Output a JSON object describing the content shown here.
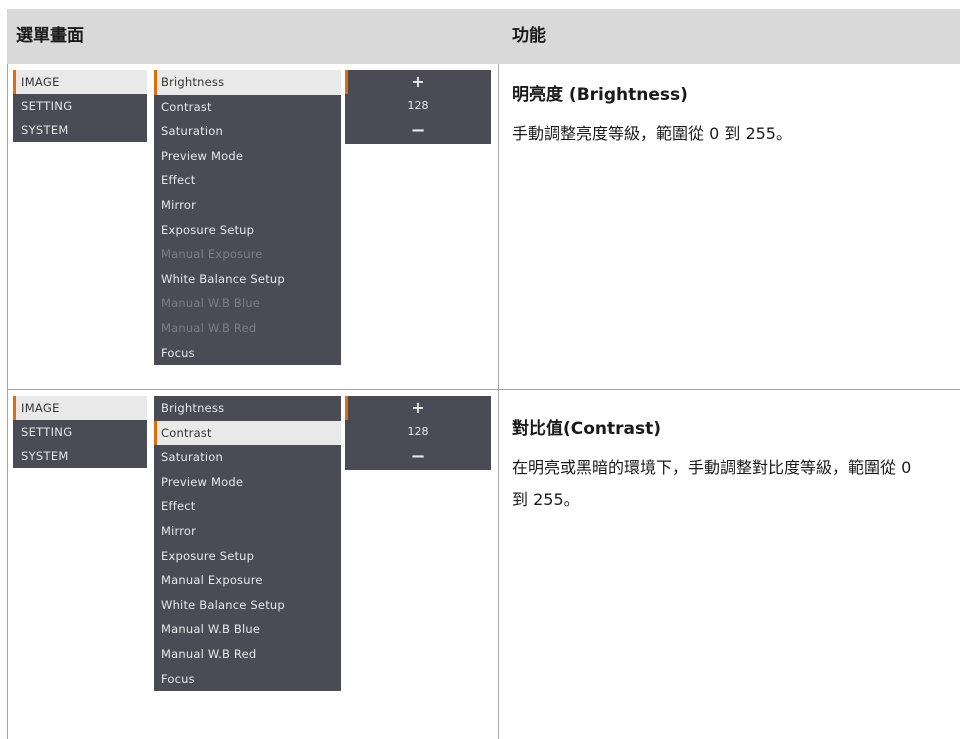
{
  "header": {
    "col1": "選單畫面",
    "col2": "功能"
  },
  "menu": {
    "categories": [
      "IMAGE",
      "SETTING",
      "SYSTEM"
    ],
    "value_panel": {
      "plus": "+",
      "value": "128",
      "minus": "−"
    }
  },
  "rows": [
    {
      "items": [
        "Brightness",
        "Contrast",
        "Saturation",
        "Preview Mode",
        "Effect",
        "Mirror",
        "Exposure Setup",
        "Manual Exposure",
        "White Balance Setup",
        "Manual W.B Blue",
        "Manual W.B Red",
        "Focus"
      ],
      "title": "明亮度 (Brightness)",
      "text": "手動調整亮度等級，範圍從 0 到 255。"
    },
    {
      "items": [
        "Brightness",
        "Contrast",
        "Saturation",
        "Preview Mode",
        "Effect",
        "Mirror",
        "Exposure Setup",
        "Manual Exposure",
        "White Balance Setup",
        "Manual W.B Blue",
        "Manual W.B Red",
        "Focus"
      ],
      "title": "對比值(Contrast)",
      "text": "在明亮或黑暗的環境下，手動調整對比度等級，範圍從 0 到 255。"
    }
  ]
}
